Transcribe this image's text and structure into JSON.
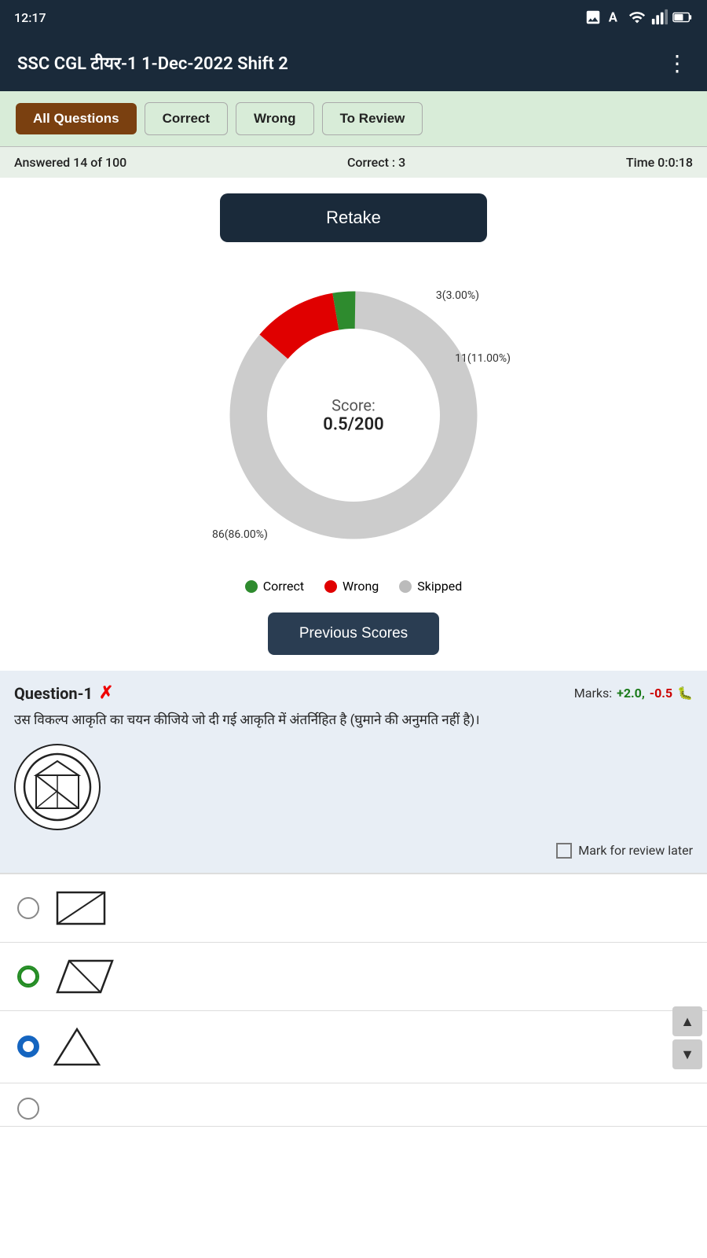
{
  "statusBar": {
    "time": "12:17",
    "icons": [
      "photo-icon",
      "a-icon",
      "wifi-icon",
      "signal-icon",
      "battery-icon"
    ]
  },
  "appBar": {
    "title": "SSC CGL टीयर-1 1-Dec-2022 Shift 2",
    "menuIcon": "⋮"
  },
  "tabs": [
    {
      "label": "All Questions",
      "active": true
    },
    {
      "label": "Correct",
      "active": false
    },
    {
      "label": "Wrong",
      "active": false
    },
    {
      "label": "To Review",
      "active": false
    }
  ],
  "stats": {
    "answered": "Answered 14 of 100",
    "correct": "Correct : 3",
    "time": "Time 0:0:18"
  },
  "retakeButton": "Retake",
  "chart": {
    "scoreLabel": "Score:",
    "scoreValue": "0.5/200",
    "correctCount": 3,
    "correctPct": "3(3.00%)",
    "wrongCount": 11,
    "wrongPct": "11(11.00%)",
    "skippedCount": 86,
    "skippedPct": "86(86.00%)",
    "total": 100
  },
  "legend": [
    {
      "label": "Correct",
      "color": "#2e8b2e"
    },
    {
      "label": "Wrong",
      "color": "#e00000"
    },
    {
      "label": "Skipped",
      "color": "#bbbbbb"
    }
  ],
  "previousScoresButton": "Previous Scores",
  "question": {
    "id": "Question-1",
    "statusIcon": "✗",
    "marksLabel": "Marks:",
    "marksPositive": "+2.0,",
    "marksNegative": "-0.5",
    "bugIcon": "🐛",
    "text": "उस विकल्प आकृति का चयन कीजिये जो दी गई आकृति में अंतर्निहित है (घुमाने की अनुमति नहीं है)।",
    "reviewLabel": "Mark for review later"
  },
  "options": [
    {
      "type": "radio-empty",
      "selected": false
    },
    {
      "type": "radio-green",
      "selected": true
    },
    {
      "type": "radio-blue",
      "selected": true
    }
  ],
  "scrollArrows": {
    "up": "▲",
    "down": "▼"
  }
}
